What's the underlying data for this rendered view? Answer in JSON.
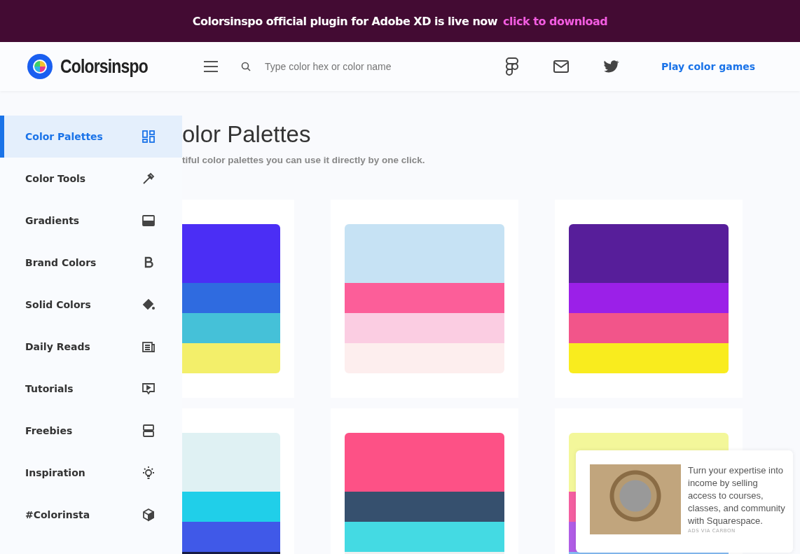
{
  "banner": {
    "text": "Colorsinspo official plugin for Adobe XD is live now",
    "link": "click to download"
  },
  "header": {
    "logo": "Colorsinspo",
    "search": {
      "placeholder": "Type color hex or color name"
    },
    "link": "Play color games"
  },
  "sidebar": {
    "items": [
      {
        "label": "Color Palettes",
        "selected": true
      },
      {
        "label": "Color Tools",
        "selected": false
      },
      {
        "label": "Gradients",
        "selected": false
      },
      {
        "label": "Brand Colors",
        "selected": false
      },
      {
        "label": "Solid Colors",
        "selected": false
      },
      {
        "label": "Daily Reads",
        "selected": false
      },
      {
        "label": "Tutorials",
        "selected": false
      },
      {
        "label": "Freebies",
        "selected": false
      },
      {
        "label": "Inspiration",
        "selected": false
      },
      {
        "label": "#Colorinsta",
        "selected": false
      }
    ]
  },
  "page": {
    "title": "olor Palettes",
    "subtitle": "tiful color palettes you can use it directly by one click."
  },
  "palettes": [
    {
      "swatches": [
        {
          "color": "#4b2ef5"
        },
        {
          "color": "#2f6be0"
        },
        {
          "color": "#45c1d8"
        },
        {
          "color": "#f3ef6a"
        }
      ]
    },
    {
      "swatches": [
        {
          "color": "#c6e2f4"
        },
        {
          "color": "#fc5e99"
        },
        {
          "color": "#fbcde2"
        },
        {
          "color": "#fdeeee"
        }
      ]
    },
    {
      "swatches": [
        {
          "color": "#571e9a"
        },
        {
          "color": "#9b20e8"
        },
        {
          "color": "#f2558a"
        },
        {
          "color": "#f9ec1e"
        }
      ]
    },
    {
      "swatches": [
        {
          "color": "#dff1f3"
        },
        {
          "color": "#20cfe9"
        },
        {
          "color": "#4059e8"
        },
        {
          "color": "#161b45"
        }
      ]
    },
    {
      "swatches": [
        {
          "color": "#fd5186"
        },
        {
          "color": "#36506e"
        },
        {
          "color": "#44dae3"
        },
        {
          "color": "#f0f0f0"
        }
      ]
    },
    {
      "swatches": [
        {
          "color": "#f3f79a"
        },
        {
          "color": "#f35fa0"
        },
        {
          "color": "#b05de5"
        },
        {
          "color": "#84b9f0"
        }
      ]
    }
  ],
  "ad": {
    "text": "Turn your expertise into income by selling access to courses, classes, and community with Squarespace.",
    "footer": "ADS VIA CARBON"
  }
}
